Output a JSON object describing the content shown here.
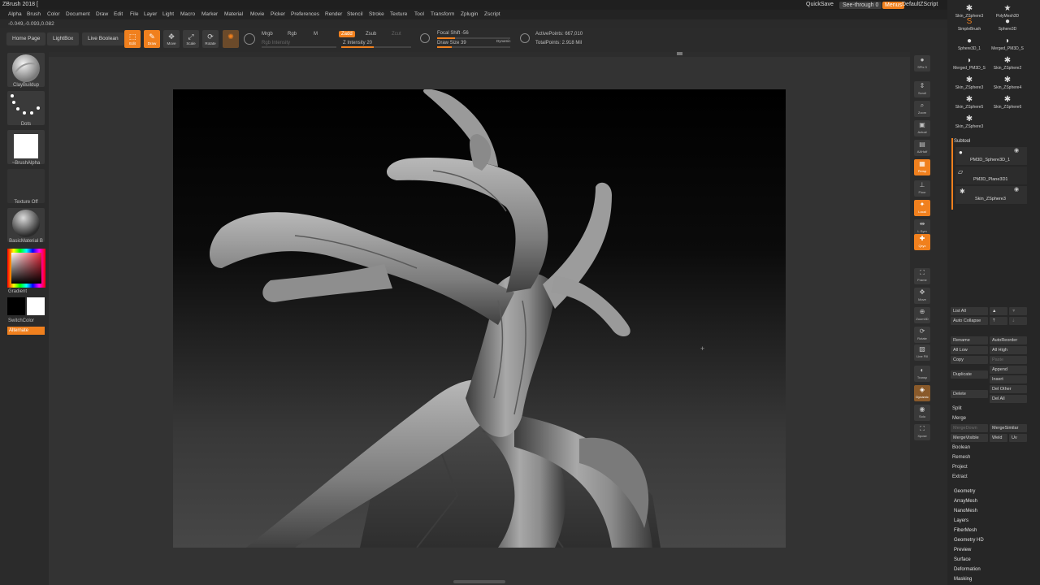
{
  "app": {
    "title": "ZBrush 2018 [",
    "coords": "-0.049,-0.093,0.082"
  },
  "menu": [
    "Alpha",
    "Brush",
    "Color",
    "Document",
    "Draw",
    "Edit",
    "File",
    "Layer",
    "Light",
    "Macro",
    "Marker",
    "Material",
    "Movie",
    "Picker",
    "Preferences",
    "Render",
    "Stencil",
    "Stroke",
    "Texture",
    "Tool",
    "Transform",
    "Zplugin",
    "Zscript"
  ],
  "topright": {
    "quicksave": "QuickSave",
    "see_through": "See-through 0",
    "menus": "Menus",
    "script": "DefaultZScript"
  },
  "shelf": {
    "home": "Home Page",
    "lightbox": "LightBox",
    "live_boolean": "Live Boolean",
    "tools": {
      "edit": "Edit",
      "draw": "Draw",
      "move": "Move",
      "scale": "Scale",
      "rotate": "Rotate"
    },
    "mrgb": "Mrgb",
    "rgb": "Rgb",
    "m": "M",
    "rgb_intensity": "Rgb Intensity",
    "zadd": "Zadd",
    "zsub": "Zsub",
    "zcut": "Zcut",
    "z_intensity": "Z Intensity 20",
    "focal_shift": "Focal Shift -56",
    "draw_size": "Draw Size 39",
    "dynamic": "Dynamic",
    "active_points": "ActivePoints: 667,010",
    "total_points": "TotalPoints: 2.918 Mil"
  },
  "left": {
    "brush": "ClayBuildup",
    "stroke": "Dots",
    "alpha": "~BrushAlpha",
    "texture": "Texture Off",
    "material": "BasicMaterial B",
    "gradient": "Gradient",
    "switch_color": "SwitchColor",
    "alternate": "Alternate"
  },
  "rightstrip": [
    {
      "label": "SPix 3",
      "icon": "sphere-icon",
      "glyph": "●"
    },
    {
      "label": "Scroll",
      "icon": "scroll-icon",
      "glyph": "⇕"
    },
    {
      "label": "Zoom",
      "icon": "zoom-icon",
      "glyph": "⌕"
    },
    {
      "label": "Actual",
      "icon": "actual-icon",
      "glyph": "▣"
    },
    {
      "label": "AAHalf",
      "icon": "aahalf-icon",
      "glyph": "▤"
    },
    {
      "label": "Persp",
      "icon": "perspective-icon",
      "glyph": "▦"
    },
    {
      "label": "Floor",
      "icon": "floor-icon",
      "glyph": "⊥"
    },
    {
      "label": "Local",
      "icon": "local-icon",
      "glyph": "✦"
    },
    {
      "label": "L.Sym",
      "icon": "lsym-icon",
      "glyph": "⇹"
    },
    {
      "label": "Qxyz",
      "icon": "xyz-icon",
      "glyph": "✚"
    },
    {
      "label": "Frame",
      "icon": "frame-icon",
      "glyph": "⛶"
    },
    {
      "label": "Move",
      "icon": "move-icon",
      "glyph": "✥"
    },
    {
      "label": "Zoom3D",
      "icon": "zoom3d-icon",
      "glyph": "⊕"
    },
    {
      "label": "Rotate",
      "icon": "rotate-icon",
      "glyph": "⟳"
    },
    {
      "label": "Line Fill",
      "icon": "linefill-icon",
      "glyph": "▧"
    },
    {
      "label": "Transp",
      "icon": "transp-icon",
      "glyph": "◐"
    },
    {
      "label": "Dynamic",
      "icon": "dynamic-icon",
      "glyph": "◈"
    },
    {
      "label": "Solo",
      "icon": "solo-icon",
      "glyph": "◉"
    },
    {
      "label": "Xpose",
      "icon": "xpose-icon",
      "glyph": "⛶"
    }
  ],
  "tools_grid": [
    {
      "name": "Skin_ZSphere3",
      "glyph": "✱"
    },
    {
      "name": "PolyMesh3D",
      "glyph": "★"
    },
    {
      "name": "SimpleBrush",
      "glyph": "S"
    },
    {
      "name": "Sphere3D",
      "glyph": "●"
    },
    {
      "name": "Sphere3D_1",
      "glyph": "●"
    },
    {
      "name": "Merged_PM3D_S",
      "glyph": "◗"
    },
    {
      "name": "Merged_PM3D_S",
      "glyph": "◗"
    },
    {
      "name": "Skin_ZSphere2",
      "glyph": "✱"
    },
    {
      "name": "Skin_ZSphere3",
      "glyph": "✱"
    },
    {
      "name": "Skin_ZSphere4",
      "glyph": "✱"
    },
    {
      "name": "Skin_ZSphere5",
      "glyph": "✱"
    },
    {
      "name": "Skin_ZSphere6",
      "glyph": "✱"
    },
    {
      "name": "Skin_ZSphere3",
      "glyph": "✱"
    }
  ],
  "subtool": {
    "title": "Subtool",
    "items": [
      "PM3D_Sphere3D_1",
      "PM3D_Plane3D1",
      "Skin_ZSphere3"
    ],
    "list_all": "List All",
    "auto_collapse": "Auto Collapse",
    "rename": "Rename",
    "autoreorder": "AutoReorder",
    "all_low": "All Low",
    "all_high": "All High",
    "copy": "Copy",
    "paste": "Paste",
    "append": "Append",
    "duplicate": "Duplicate",
    "insert": "Insert",
    "delete": "Delete",
    "del_other": "Del Other",
    "del_all": "Del All",
    "split": "Split",
    "merge": "Merge",
    "merge_down": "MergeDown",
    "merge_similar": "MergeSimilar",
    "merge_visible": "MergeVisible",
    "weld": "Weld",
    "uv": "Uv",
    "boolean": "Boolean",
    "remesh": "Remesh",
    "project": "Project",
    "extract": "Extract"
  },
  "sections": [
    "Geometry",
    "ArrayMesh",
    "NanoMesh",
    "Layers",
    "FiberMesh",
    "Geometry HD",
    "Preview",
    "Surface",
    "Deformation",
    "Masking"
  ],
  "colors": {
    "accent": "#f0801e",
    "panel": "#262626",
    "canvas_top": "#000000",
    "canvas_bottom": "#474747"
  }
}
